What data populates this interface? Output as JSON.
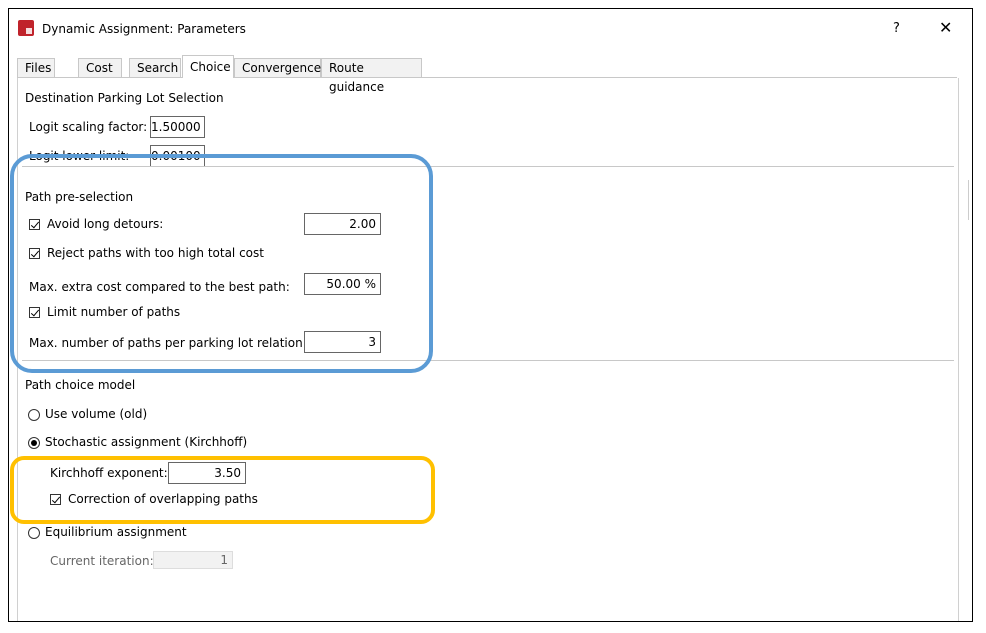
{
  "window": {
    "title": "Dynamic Assignment: Parameters",
    "help_label": "?",
    "close_label": "✕"
  },
  "tabs": [
    {
      "label": "Files",
      "active": false
    },
    {
      "label": "Cost",
      "active": false
    },
    {
      "label": "Search",
      "active": false
    },
    {
      "label": "Choice",
      "active": true
    },
    {
      "label": "Convergence",
      "active": false
    },
    {
      "label": "Route guidance",
      "active": false
    }
  ],
  "destination": {
    "heading": "Destination Parking Lot Selection",
    "logit_scaling_label": "Logit scaling factor:",
    "logit_scaling_value": "1.50000",
    "logit_lower_label": "Logit lower limit:",
    "logit_lower_value": "0.00100"
  },
  "preselection": {
    "heading": "Path pre-selection",
    "avoid_detours_label": "Avoid long detours:",
    "avoid_detours_checked": true,
    "avoid_detours_value": "2.00",
    "reject_paths_label": "Reject paths with too high total cost",
    "reject_paths_checked": true,
    "max_extra_cost_label": "Max. extra cost compared to the best path:",
    "max_extra_cost_value": "50.00 %",
    "limit_paths_label": "Limit number of paths",
    "limit_paths_checked": true,
    "max_paths_label": "Max. number of paths per parking lot relation:",
    "max_paths_value": "3"
  },
  "choice_model": {
    "heading": "Path choice model",
    "use_volume_label": "Use volume (old)",
    "stochastic_label": "Stochastic assignment (Kirchhoff)",
    "selected": "stochastic",
    "kirchhoff_label": "Kirchhoff exponent:",
    "kirchhoff_value": "3.50",
    "overlap_label": "Correction of overlapping paths",
    "overlap_checked": true,
    "equilibrium_label": "Equilibrium assignment",
    "current_iteration_label": "Current iteration:",
    "current_iteration_value": "1"
  },
  "highlight_colors": {
    "blue": "#5b9bd5",
    "yellow": "#ffc000"
  }
}
